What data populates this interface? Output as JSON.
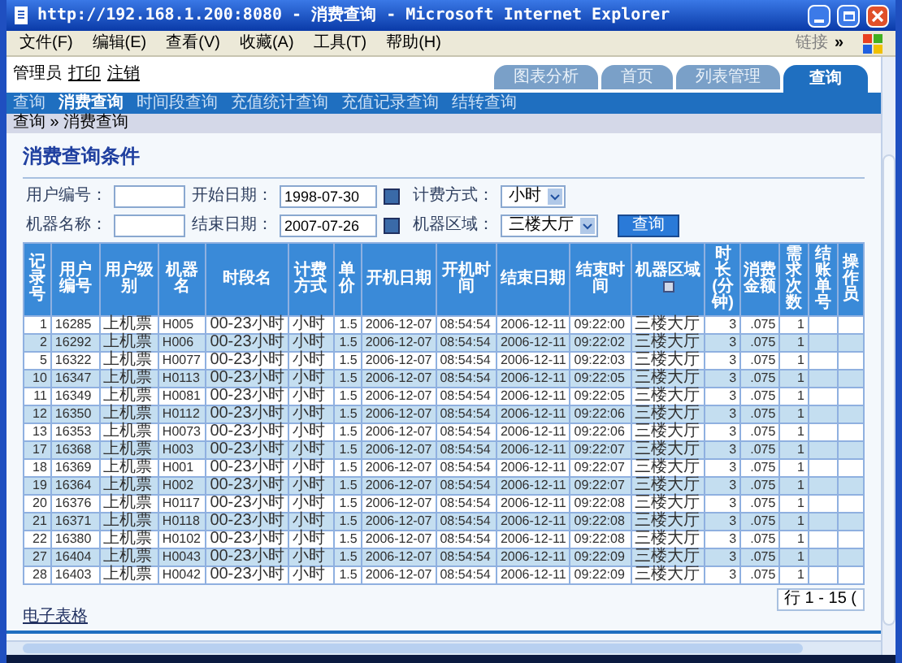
{
  "window": {
    "title": "http://192.168.1.200:8080 - 消费查询 - Microsoft Internet Explorer"
  },
  "menu_bar": {
    "items": [
      "文件(F)",
      "编辑(E)",
      "查看(V)",
      "收藏(A)",
      "工具(T)",
      "帮助(H)"
    ],
    "links_label": "链接",
    "chevron": "»"
  },
  "header": {
    "user": "管理员",
    "links": [
      "打印",
      "注销"
    ],
    "tabs": [
      {
        "label": "图表分析",
        "selected": false
      },
      {
        "label": "首页",
        "selected": false
      },
      {
        "label": "列表管理",
        "selected": false
      },
      {
        "label": "查询",
        "selected": true
      }
    ]
  },
  "nav": [
    {
      "label": "查询",
      "selected": false
    },
    {
      "label": "消费查询",
      "selected": true
    },
    {
      "label": "时间段查询",
      "selected": false
    },
    {
      "label": "充值统计查询",
      "selected": false
    },
    {
      "label": "充值记录查询",
      "selected": false
    },
    {
      "label": "结转查询",
      "selected": false
    }
  ],
  "breadcrumb": "查询 » 消费查询",
  "section_title": "消费查询条件",
  "form": {
    "fields": [
      {
        "label": "用户编号：",
        "kind": "text"
      },
      {
        "label": "开始日期：",
        "kind": "date",
        "value": "1998-07-30"
      },
      {
        "label": "计费方式：",
        "kind": "select",
        "value": "小时"
      },
      {
        "label": "机器名称：",
        "kind": "text"
      },
      {
        "label": "结束日期：",
        "kind": "date",
        "value": "2007-07-26"
      },
      {
        "label": "机器区域：",
        "kind": "select",
        "value": "三楼大厅"
      }
    ],
    "button": "查询"
  },
  "table": {
    "columns": [
      {
        "label": "记录号",
        "sorted": false
      },
      {
        "label": "用户编号",
        "sorted": false
      },
      {
        "label": "用户级别",
        "sorted": false
      },
      {
        "label": "机器名",
        "sorted": false
      },
      {
        "label": "时段名",
        "sorted": false
      },
      {
        "label": "计费方式",
        "sorted": false
      },
      {
        "label": "单价",
        "sorted": false
      },
      {
        "label": "开机日期",
        "sorted": false
      },
      {
        "label": "开机时间",
        "sorted": false
      },
      {
        "label": "结束日期",
        "sorted": false
      },
      {
        "label": "结束时间",
        "sorted": false
      },
      {
        "label": "机器区域",
        "sorted": true
      },
      {
        "label": "时长(分钟)",
        "sorted": false
      },
      {
        "label": "消费金额",
        "sorted": false
      },
      {
        "label": "需求次数",
        "sorted": false
      },
      {
        "label": "结账单号",
        "sorted": false
      },
      {
        "label": "操作员",
        "sorted": false
      }
    ],
    "rows": [
      {
        "cells": [
          "1",
          "16285",
          "上机票",
          "H005",
          "00-23小时",
          "小时",
          "1.5",
          "2006-12-07",
          "08:54:54",
          "2006-12-11",
          "09:22:00",
          "三楼大厅",
          "3",
          ".075",
          "1"
        ]
      },
      {
        "cells": [
          "2",
          "16292",
          "上机票",
          "H006",
          "00-23小时",
          "小时",
          "1.5",
          "2006-12-07",
          "08:54:54",
          "2006-12-11",
          "09:22:02",
          "三楼大厅",
          "3",
          ".075",
          "1"
        ]
      },
      {
        "cells": [
          "5",
          "16322",
          "上机票",
          "H0077",
          "00-23小时",
          "小时",
          "1.5",
          "2006-12-07",
          "08:54:54",
          "2006-12-11",
          "09:22:03",
          "三楼大厅",
          "3",
          ".075",
          "1"
        ]
      },
      {
        "cells": [
          "10",
          "16347",
          "上机票",
          "H0113",
          "00-23小时",
          "小时",
          "1.5",
          "2006-12-07",
          "08:54:54",
          "2006-12-11",
          "09:22:05",
          "三楼大厅",
          "3",
          ".075",
          "1"
        ]
      },
      {
        "cells": [
          "11",
          "16349",
          "上机票",
          "H0081",
          "00-23小时",
          "小时",
          "1.5",
          "2006-12-07",
          "08:54:54",
          "2006-12-11",
          "09:22:05",
          "三楼大厅",
          "3",
          ".075",
          "1"
        ]
      },
      {
        "cells": [
          "12",
          "16350",
          "上机票",
          "H0112",
          "00-23小时",
          "小时",
          "1.5",
          "2006-12-07",
          "08:54:54",
          "2006-12-11",
          "09:22:06",
          "三楼大厅",
          "3",
          ".075",
          "1"
        ]
      },
      {
        "cells": [
          "13",
          "16353",
          "上机票",
          "H0073",
          "00-23小时",
          "小时",
          "1.5",
          "2006-12-07",
          "08:54:54",
          "2006-12-11",
          "09:22:06",
          "三楼大厅",
          "3",
          ".075",
          "1"
        ]
      },
      {
        "cells": [
          "17",
          "16368",
          "上机票",
          "H003",
          "00-23小时",
          "小时",
          "1.5",
          "2006-12-07",
          "08:54:54",
          "2006-12-11",
          "09:22:07",
          "三楼大厅",
          "3",
          ".075",
          "1"
        ]
      },
      {
        "cells": [
          "18",
          "16369",
          "上机票",
          "H001",
          "00-23小时",
          "小时",
          "1.5",
          "2006-12-07",
          "08:54:54",
          "2006-12-11",
          "09:22:07",
          "三楼大厅",
          "3",
          ".075",
          "1"
        ]
      },
      {
        "cells": [
          "19",
          "16364",
          "上机票",
          "H002",
          "00-23小时",
          "小时",
          "1.5",
          "2006-12-07",
          "08:54:54",
          "2006-12-11",
          "09:22:07",
          "三楼大厅",
          "3",
          ".075",
          "1"
        ]
      },
      {
        "cells": [
          "20",
          "16376",
          "上机票",
          "H0117",
          "00-23小时",
          "小时",
          "1.5",
          "2006-12-07",
          "08:54:54",
          "2006-12-11",
          "09:22:08",
          "三楼大厅",
          "3",
          ".075",
          "1"
        ]
      },
      {
        "cells": [
          "21",
          "16371",
          "上机票",
          "H0118",
          "00-23小时",
          "小时",
          "1.5",
          "2006-12-07",
          "08:54:54",
          "2006-12-11",
          "09:22:08",
          "三楼大厅",
          "3",
          ".075",
          "1"
        ]
      },
      {
        "cells": [
          "22",
          "16380",
          "上机票",
          "H0102",
          "00-23小时",
          "小时",
          "1.5",
          "2006-12-07",
          "08:54:54",
          "2006-12-11",
          "09:22:08",
          "三楼大厅",
          "3",
          ".075",
          "1"
        ]
      },
      {
        "cells": [
          "27",
          "16404",
          "上机票",
          "H0043",
          "00-23小时",
          "小时",
          "1.5",
          "2006-12-07",
          "08:54:54",
          "2006-12-11",
          "09:22:09",
          "三楼大厅",
          "3",
          ".075",
          "1"
        ]
      },
      {
        "cells": [
          "28",
          "16403",
          "上机票",
          "H0042",
          "00-23小时",
          "小时",
          "1.5",
          "2006-12-07",
          "08:54:54",
          "2006-12-11",
          "09:22:09",
          "三楼大厅",
          "3",
          ".075",
          "1"
        ]
      }
    ]
  },
  "pager": "行 1 - 15 (",
  "export_link": "电子表格"
}
